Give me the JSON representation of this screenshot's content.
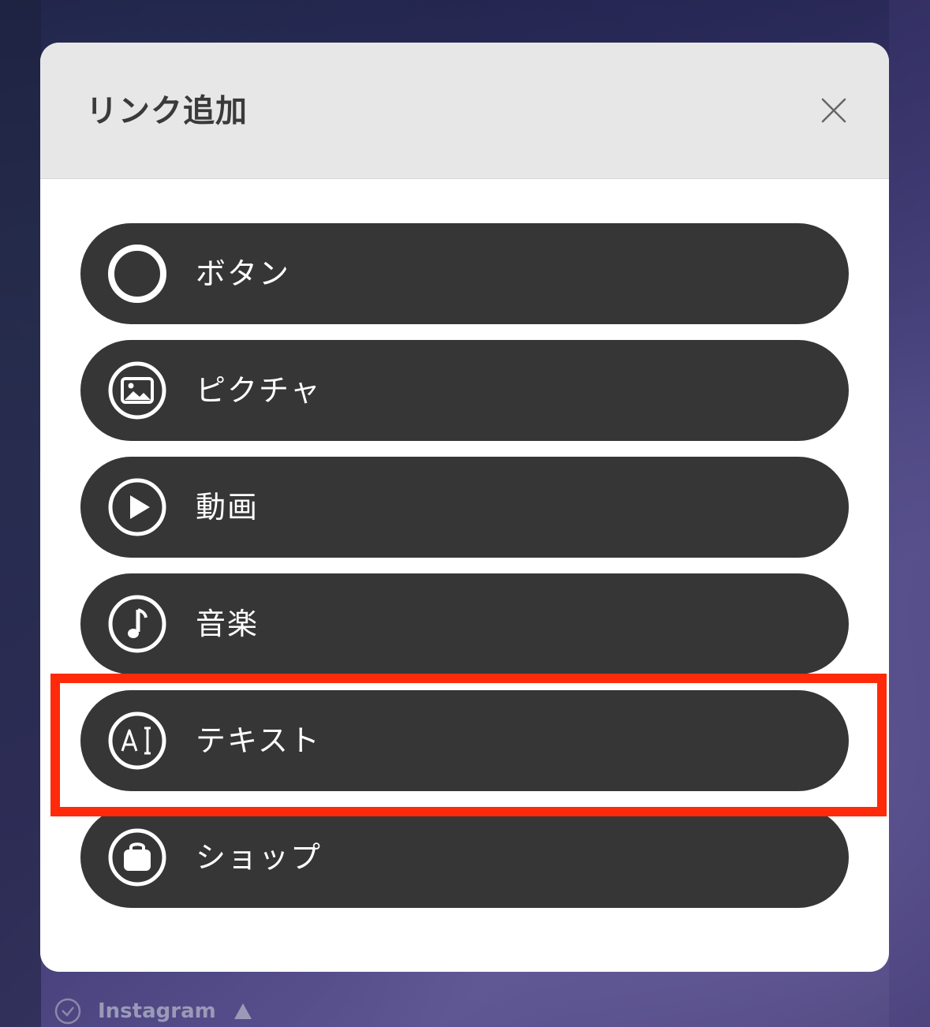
{
  "modal": {
    "title": "リンク追加"
  },
  "items": [
    {
      "label": "ボタン",
      "icon": "circle-icon"
    },
    {
      "label": "ピクチャ",
      "icon": "image-icon"
    },
    {
      "label": "動画",
      "icon": "play-icon"
    },
    {
      "label": "音楽",
      "icon": "music-note-icon"
    },
    {
      "label": "テキスト",
      "icon": "text-icon",
      "highlighted": true
    },
    {
      "label": "ショップ",
      "icon": "shopping-bag-icon"
    }
  ],
  "background": {
    "footer_label": "Instagram"
  },
  "colors": {
    "item_bg": "#363636",
    "header_bg": "#e7e7e7",
    "highlight": "#ff2a0a"
  }
}
